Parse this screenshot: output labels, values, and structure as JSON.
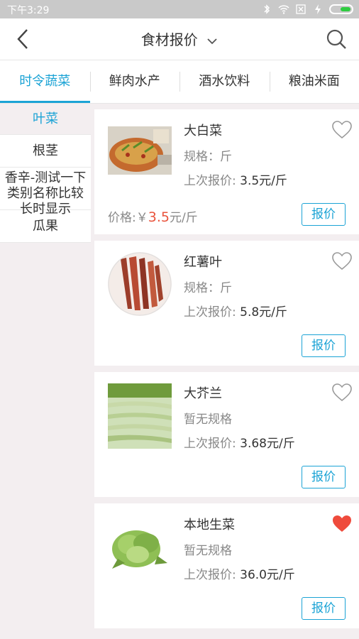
{
  "status_bar": {
    "time": "下午3:29"
  },
  "header": {
    "title": "食材报价"
  },
  "tabs": [
    {
      "label": "时令蔬菜",
      "active": true
    },
    {
      "label": "鲜肉水产",
      "active": false
    },
    {
      "label": "酒水饮料",
      "active": false
    },
    {
      "label": "粮油米面",
      "active": false
    }
  ],
  "sidebar": [
    {
      "label": "叶菜",
      "active": true
    },
    {
      "label": "根茎",
      "active": false
    },
    {
      "label": "香辛-测试一下类别名称比较长时显示",
      "active": false
    },
    {
      "label": "瓜果",
      "active": false
    }
  ],
  "items": [
    {
      "name": "大白菜",
      "spec": "规格：斤",
      "last_label": "上次报价: ",
      "last_value": "3.5元/斤",
      "price_label": "价格:￥",
      "price_value": "3.5",
      "price_unit": "元/斤",
      "favorited": false,
      "button": "报价"
    },
    {
      "name": "红薯叶",
      "spec": "规格：斤",
      "last_label": "上次报价: ",
      "last_value": "5.8元/斤",
      "favorited": false,
      "button": "报价"
    },
    {
      "name": "大芥兰",
      "spec": "暂无规格",
      "last_label": "上次报价: ",
      "last_value": "3.68元/斤",
      "favorited": false,
      "button": "报价"
    },
    {
      "name": "本地生菜",
      "spec": "暂无规格",
      "last_label": "上次报价: ",
      "last_value": "36.0元/斤",
      "favorited": true,
      "button": "报价"
    }
  ],
  "colors": {
    "accent": "#1ba3d5",
    "price": "#e9543d",
    "heart_active": "#ef4b3c"
  }
}
